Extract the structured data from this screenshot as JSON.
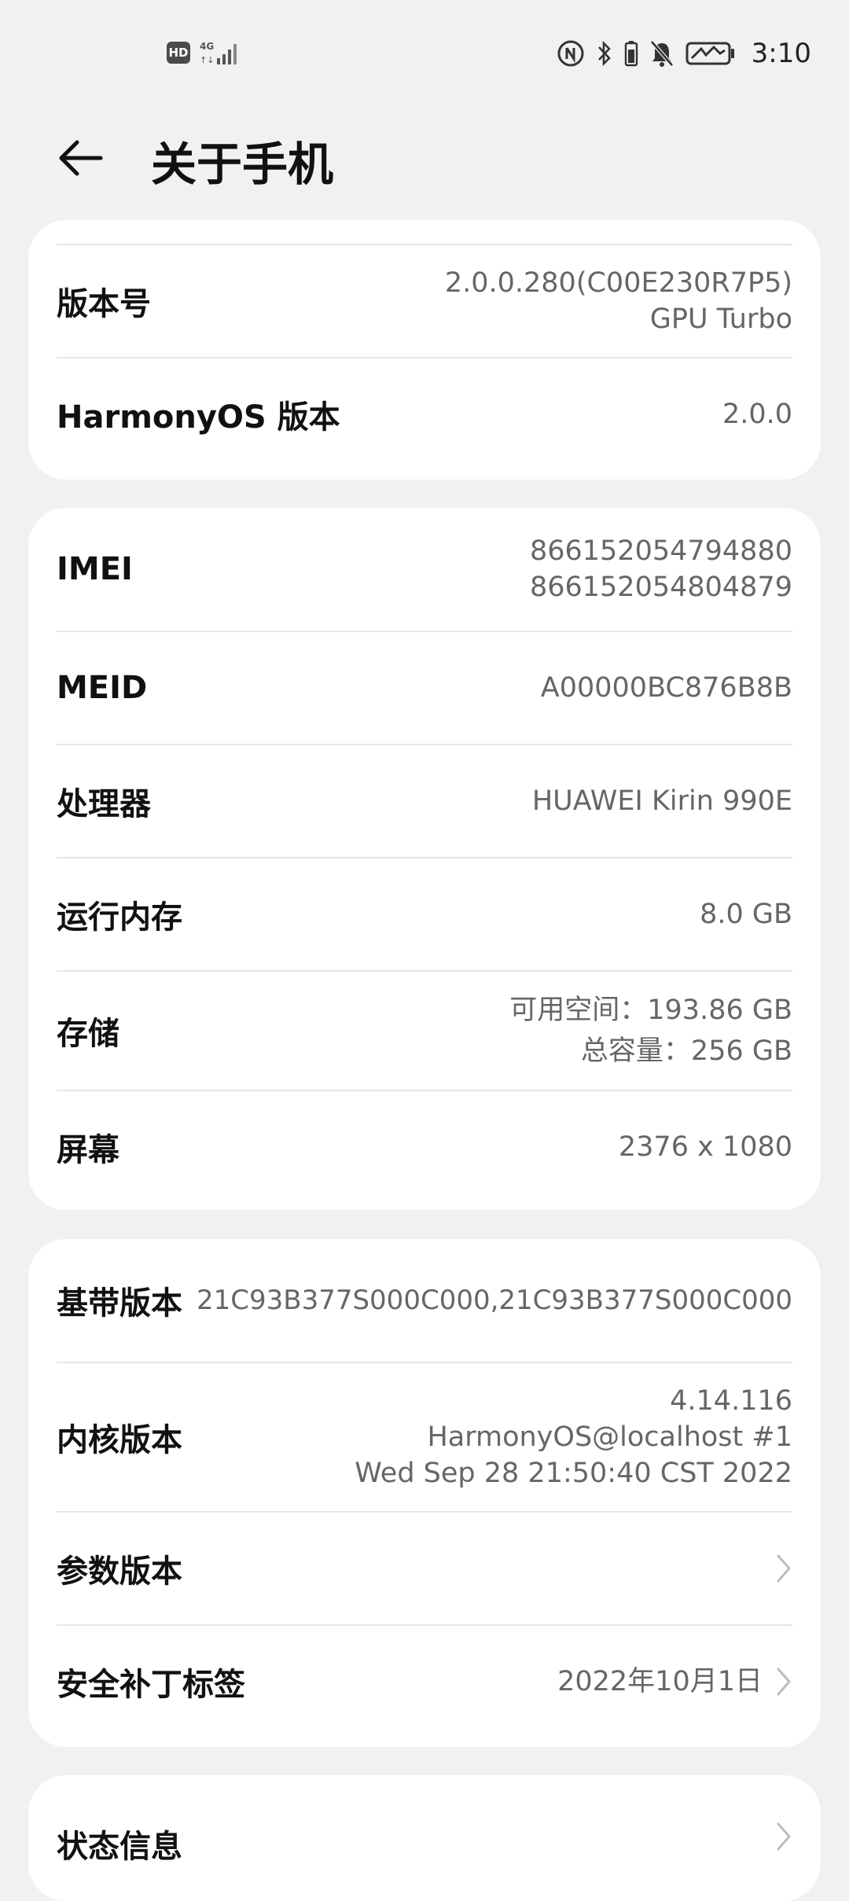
{
  "status_bar": {
    "hd": "HD",
    "network": "4G",
    "time": "3:10"
  },
  "header": {
    "title": "关于手机"
  },
  "card1": {
    "rows": [
      {
        "label": "版本号",
        "value_line1": "2.0.0.280(C00E230R7P5)",
        "value_line2": "GPU Turbo"
      },
      {
        "label": "HarmonyOS 版本",
        "value": "2.0.0"
      }
    ]
  },
  "card2": {
    "rows": [
      {
        "label": "IMEI",
        "value_line1": "866152054794880",
        "value_line2": "866152054804879"
      },
      {
        "label": "MEID",
        "value": "A00000BC876B8B"
      },
      {
        "label": "处理器",
        "value": "HUAWEI Kirin 990E"
      },
      {
        "label": "运行内存",
        "value": "8.0 GB"
      },
      {
        "label": "存储",
        "value_line1": "可用空间：193.86  GB",
        "value_line2": "总容量：256  GB"
      },
      {
        "label": "屏幕",
        "value": "2376 x 1080"
      }
    ]
  },
  "card3": {
    "rows": [
      {
        "label": "基带版本",
        "value": "21C93B377S000C000,21C93B377S000C000"
      },
      {
        "label": "内核版本",
        "value_line1": "4.14.116",
        "value_line2": "HarmonyOS@localhost #1",
        "value_line3": "Wed Sep 28 21:50:40 CST 2022"
      },
      {
        "label": "参数版本",
        "value": ""
      },
      {
        "label": "安全补丁标签",
        "value": "2022年10月1日"
      }
    ]
  },
  "card4": {
    "rows": [
      {
        "label": "状态信息"
      }
    ]
  },
  "colors": {
    "background": "#f1f1f3",
    "card": "#ffffff",
    "value_text": "#666666"
  }
}
